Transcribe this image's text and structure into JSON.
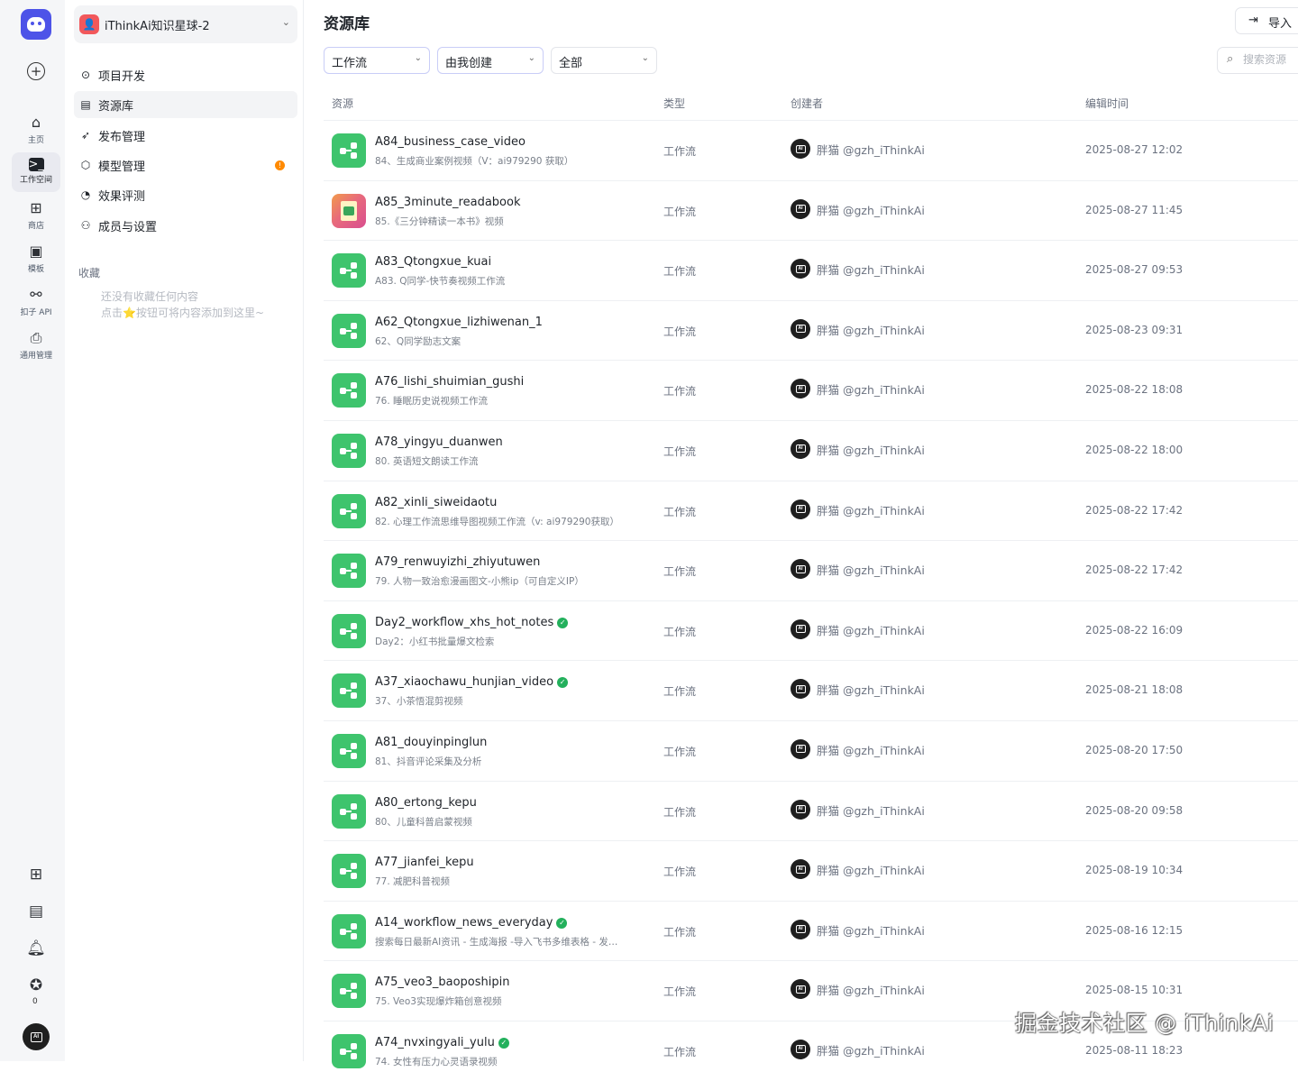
{
  "rail": {
    "items": [
      {
        "label": "主页",
        "icon": "home-icon"
      },
      {
        "label": "工作空间",
        "icon": "terminal-icon"
      },
      {
        "label": "商店",
        "icon": "store-icon"
      },
      {
        "label": "模板",
        "icon": "template-icon"
      },
      {
        "label": "扣子 API",
        "icon": "api-icon"
      },
      {
        "label": "通用管理",
        "icon": "inbox-icon"
      }
    ],
    "favorites_count": "0"
  },
  "sidebar": {
    "space_name": "iThinkAi知识星球-2",
    "space_initial": "👤",
    "nav": [
      {
        "label": "项目开发",
        "icon": "project-icon"
      },
      {
        "label": "资源库",
        "icon": "library-icon"
      },
      {
        "label": "发布管理",
        "icon": "rocket-icon"
      },
      {
        "label": "模型管理",
        "icon": "model-icon",
        "badge": "!"
      },
      {
        "label": "效果评测",
        "icon": "gauge-icon"
      },
      {
        "label": "成员与设置",
        "icon": "members-icon"
      }
    ],
    "favorites_title": "收藏",
    "favorites_empty_1": "还没有收藏任何内容",
    "favorites_empty_2": "点击⭐按钮可将内容添加到这里~"
  },
  "header": {
    "title": "资源库",
    "import_label": "导入",
    "filter_type": "工作流",
    "filter_owner": "由我创建",
    "filter_status": "全部",
    "search_placeholder": "搜索资源"
  },
  "table": {
    "columns": [
      "资源",
      "类型",
      "创建者",
      "编辑时间"
    ],
    "rows": [
      {
        "name": "A84_business_case_video",
        "desc": "84、生成商业案例视频（V：ai979290 获取）",
        "type": "工作流",
        "creator": "胖猫 @gzh_iThinkAi",
        "time": "2025-08-27 12:02",
        "icon": "workflow",
        "verified": false
      },
      {
        "name": "A85_3minute_readabook",
        "desc": "85.《三分钟精读一本书》视频",
        "type": "工作流",
        "creator": "胖猫 @gzh_iThinkAi",
        "time": "2025-08-27 11:45",
        "icon": "image",
        "verified": false
      },
      {
        "name": "A83_Qtongxue_kuai",
        "desc": "A83. Q同学-快节奏视频工作流",
        "type": "工作流",
        "creator": "胖猫 @gzh_iThinkAi",
        "time": "2025-08-27 09:53",
        "icon": "workflow",
        "verified": false
      },
      {
        "name": "A62_Qtongxue_lizhiwenan_1",
        "desc": "62、Q同学励志文案",
        "type": "工作流",
        "creator": "胖猫 @gzh_iThinkAi",
        "time": "2025-08-23 09:31",
        "icon": "workflow",
        "verified": false
      },
      {
        "name": "A76_lishi_shuimian_gushi",
        "desc": "76. 睡眠历史说视频工作流",
        "type": "工作流",
        "creator": "胖猫 @gzh_iThinkAi",
        "time": "2025-08-22 18:08",
        "icon": "workflow",
        "verified": false
      },
      {
        "name": "A78_yingyu_duanwen",
        "desc": "80. 英语短文朗读工作流",
        "type": "工作流",
        "creator": "胖猫 @gzh_iThinkAi",
        "time": "2025-08-22 18:00",
        "icon": "workflow",
        "verified": false
      },
      {
        "name": "A82_xinli_siweidaotu",
        "desc": "82. 心理工作流思维导图视频工作流（v: ai979290获取）",
        "type": "工作流",
        "creator": "胖猫 @gzh_iThinkAi",
        "time": "2025-08-22 17:42",
        "icon": "workflow",
        "verified": false
      },
      {
        "name": "A79_renwuyizhi_zhiyutuwen",
        "desc": "79. 人物一致治愈漫画图文-小熊ip（可自定义IP）",
        "type": "工作流",
        "creator": "胖猫 @gzh_iThinkAi",
        "time": "2025-08-22 17:42",
        "icon": "workflow",
        "verified": false
      },
      {
        "name": "Day2_workflow_xhs_hot_notes",
        "desc": "Day2：小红书批量爆文检索",
        "type": "工作流",
        "creator": "胖猫 @gzh_iThinkAi",
        "time": "2025-08-22 16:09",
        "icon": "workflow",
        "verified": true
      },
      {
        "name": "A37_xiaochawu_hunjian_video",
        "desc": "37、小茶悟混剪视频",
        "type": "工作流",
        "creator": "胖猫 @gzh_iThinkAi",
        "time": "2025-08-21 18:08",
        "icon": "workflow",
        "verified": true
      },
      {
        "name": "A81_douyinpinglun",
        "desc": "81、抖音评论采集及分析",
        "type": "工作流",
        "creator": "胖猫 @gzh_iThinkAi",
        "time": "2025-08-20 17:50",
        "icon": "workflow",
        "verified": false
      },
      {
        "name": "A80_ertong_kepu",
        "desc": "80、儿童科普启蒙视频",
        "type": "工作流",
        "creator": "胖猫 @gzh_iThinkAi",
        "time": "2025-08-20 09:58",
        "icon": "workflow",
        "verified": false
      },
      {
        "name": "A77_jianfei_kepu",
        "desc": "77. 减肥科普视频",
        "type": "工作流",
        "creator": "胖猫 @gzh_iThinkAi",
        "time": "2025-08-19 10:34",
        "icon": "workflow",
        "verified": false
      },
      {
        "name": "A14_workflow_news_everyday",
        "desc": "搜索每日最新AI资讯 - 生成海报 -导入飞书多维表格 - 发…",
        "type": "工作流",
        "creator": "胖猫 @gzh_iThinkAi",
        "time": "2025-08-16 12:15",
        "icon": "workflow",
        "verified": true
      },
      {
        "name": "A75_veo3_baoposhipin",
        "desc": "75. Veo3实现爆炸箱创意视频",
        "type": "工作流",
        "creator": "胖猫 @gzh_iThinkAi",
        "time": "2025-08-15 10:31",
        "icon": "workflow",
        "verified": false
      },
      {
        "name": "A74_nvxingyali_yulu",
        "desc": "74. 女性有压力心灵语录视频",
        "type": "工作流",
        "creator": "胖猫 @gzh_iThinkAi",
        "time": "2025-08-11 18:23",
        "icon": "workflow",
        "verified": true
      }
    ]
  },
  "watermark": "掘金技术社区 @ iThinkAi",
  "colors": {
    "accent": "#4d53e8",
    "workflow_icon": "#3ec46d",
    "verified": "#23b05c",
    "alert": "#ff8a00"
  }
}
